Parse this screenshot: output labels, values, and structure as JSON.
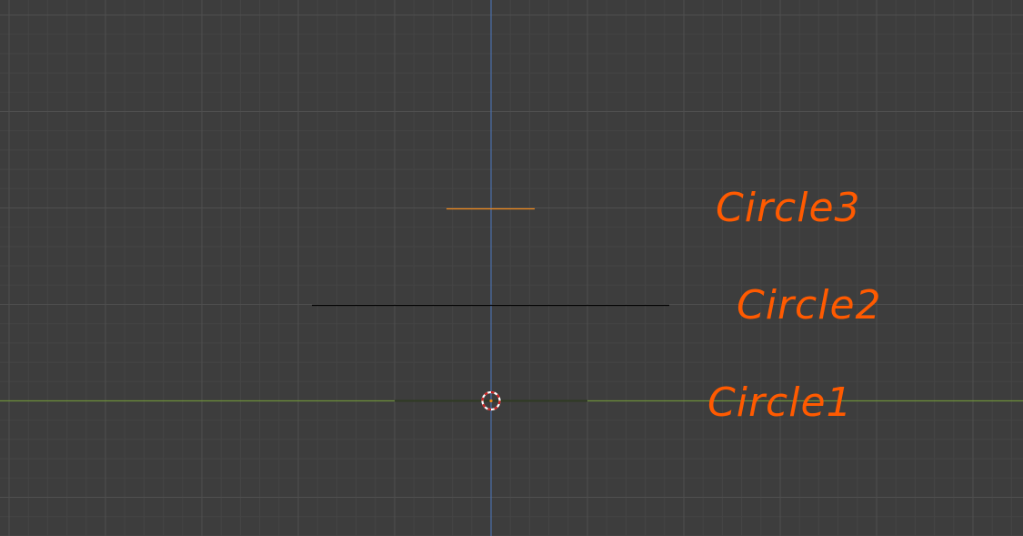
{
  "app": {
    "view": "Blender 3D Viewport (orthographic, wireframe)"
  },
  "colors": {
    "background": "#3d3d3d",
    "grid_minor": "#454545",
    "grid_major": "#4f4f4f",
    "z_axis": "#4b6ea8",
    "x_axis": "#6e8f3a",
    "selected_object": "#f0881a",
    "unselected_object": "#000000",
    "annotation": "#ff5a00"
  },
  "objects": [
    {
      "name": "Circle3",
      "state": "selected"
    },
    {
      "name": "Circle2",
      "state": "unselected"
    },
    {
      "name": "Circle1",
      "state": "unselected"
    }
  ],
  "annotations": {
    "circle3": "Circle3",
    "circle2": "Circle2",
    "circle1": "Circle1"
  },
  "icons": {
    "origin_cursor": "3d-cursor-icon"
  }
}
